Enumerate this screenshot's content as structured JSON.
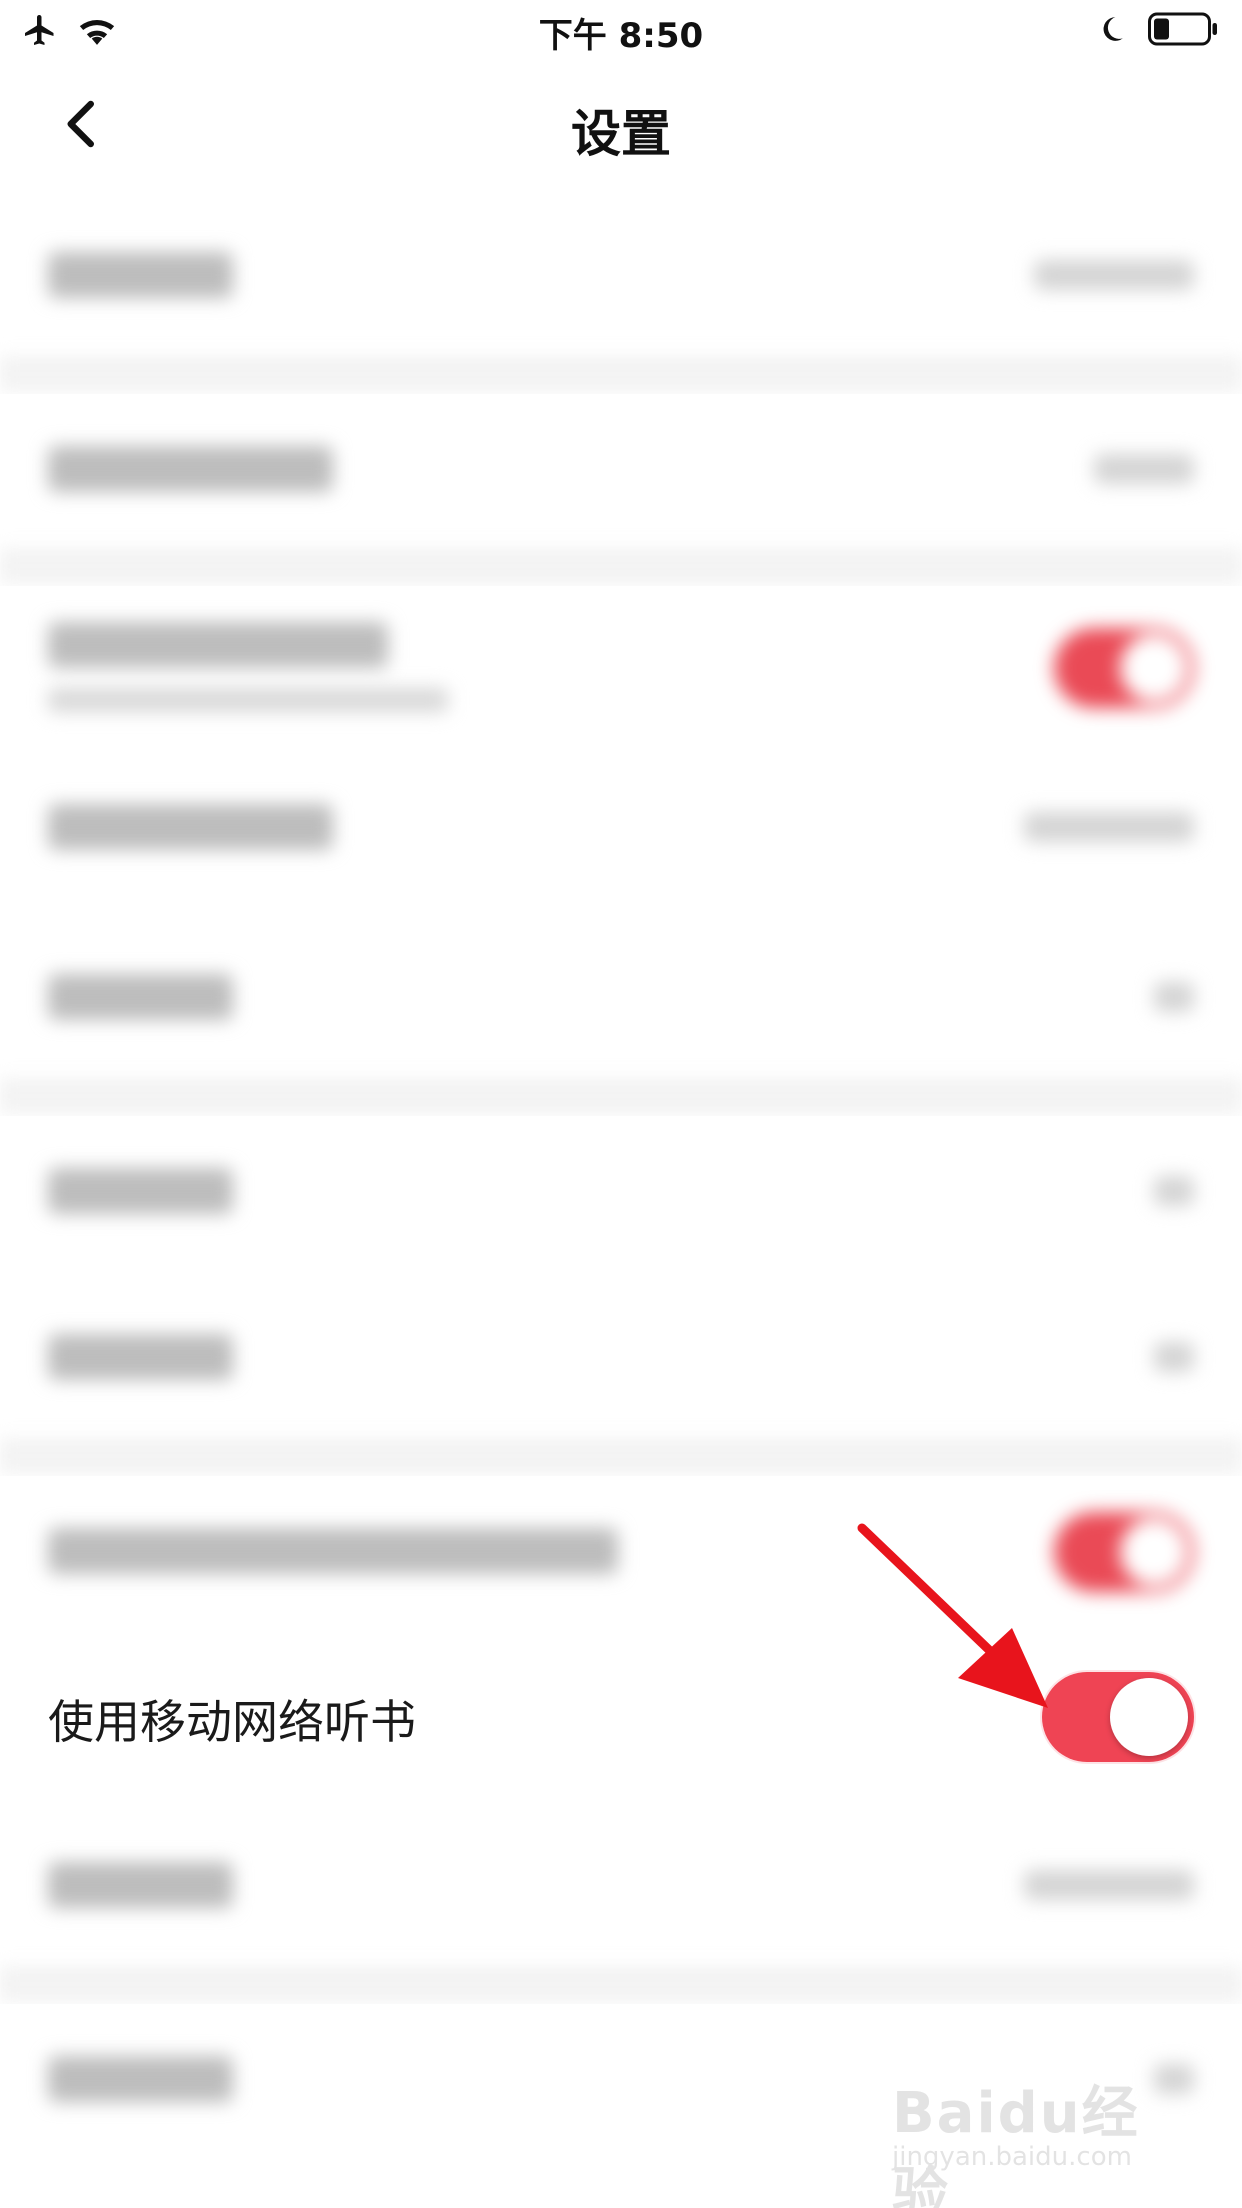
{
  "status_bar": {
    "time": "下午 8:50",
    "icons_left": [
      "airplane-icon",
      "wifi-icon"
    ],
    "icons_right": [
      "moon-icon",
      "battery-icon"
    ]
  },
  "nav": {
    "title": "设置",
    "back_icon": "chevron-left-icon"
  },
  "settings": {
    "focused_item": {
      "label": "使用移动网络听书",
      "toggle_on": true
    }
  },
  "colors": {
    "accent": "#ef4454",
    "separator": "#f3f3f3",
    "text": "#1a1a1a",
    "arrow": "#e8141c"
  },
  "watermark": {
    "main": "Baidu经验",
    "sub": "jingyan.baidu.com"
  }
}
